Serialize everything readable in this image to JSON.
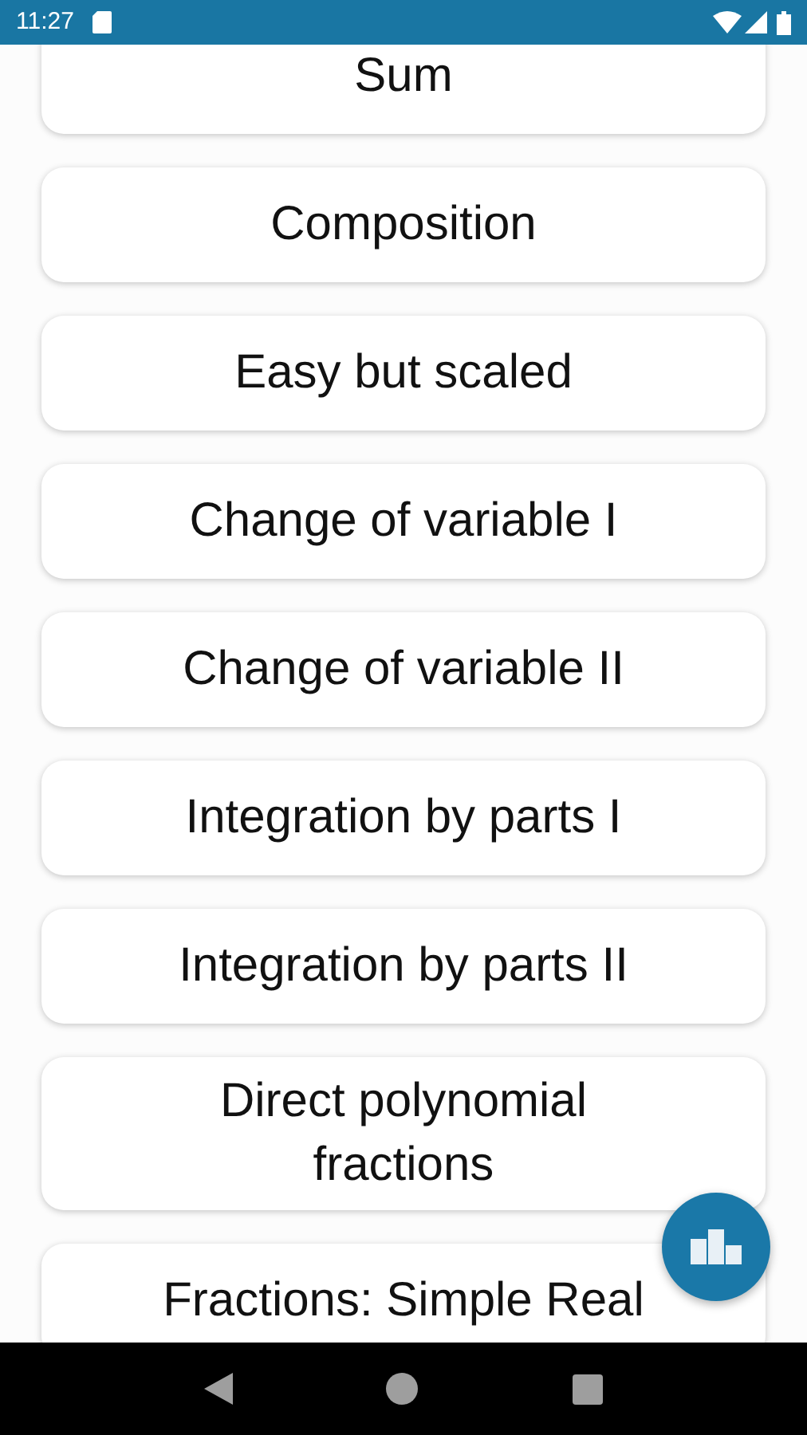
{
  "status_bar": {
    "time": "11:27"
  },
  "topics": [
    {
      "label": "Sum"
    },
    {
      "label": "Composition"
    },
    {
      "label": "Easy but scaled"
    },
    {
      "label": "Change of variable I"
    },
    {
      "label": "Change of variable II"
    },
    {
      "label": "Integration by parts I"
    },
    {
      "label": "Integration by parts II"
    },
    {
      "label": "Direct polynomial fractions"
    },
    {
      "label": "Fractions: Simple Real"
    }
  ]
}
